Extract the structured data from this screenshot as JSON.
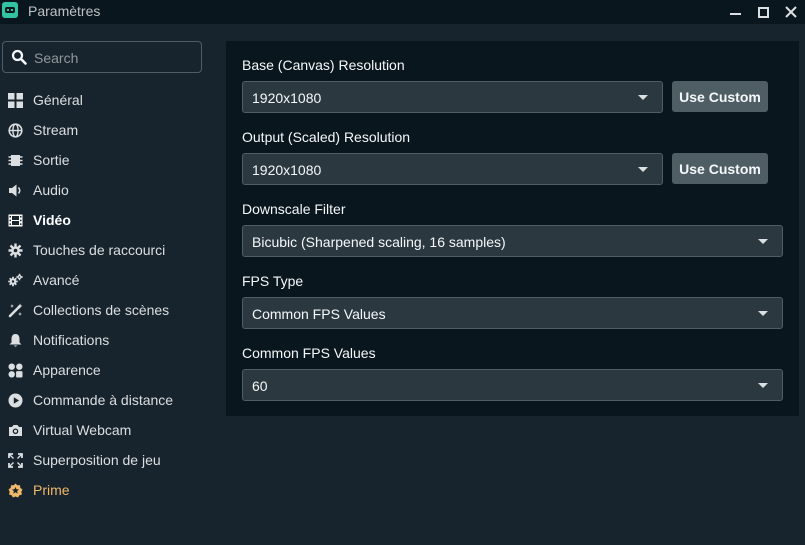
{
  "window": {
    "title": "Paramètres",
    "icons": {
      "app": "streamlabs-logo-icon",
      "minimize": "minimize-icon",
      "maximize": "maximize-icon",
      "close": "close-icon"
    }
  },
  "search": {
    "placeholder": "Search",
    "value": ""
  },
  "sidebar": {
    "items": [
      {
        "label": "Général",
        "icon": "grid-icon"
      },
      {
        "label": "Stream",
        "icon": "globe-icon"
      },
      {
        "label": "Sortie",
        "icon": "chip-icon"
      },
      {
        "label": "Audio",
        "icon": "speaker-icon"
      },
      {
        "label": "Vidéo",
        "icon": "film-icon",
        "active": true
      },
      {
        "label": "Touches de raccourci",
        "icon": "gear-icon"
      },
      {
        "label": "Avancé",
        "icon": "gears-icon"
      },
      {
        "label": "Collections de scènes",
        "icon": "magic-wand-icon"
      },
      {
        "label": "Notifications",
        "icon": "bell-icon"
      },
      {
        "label": "Apparence",
        "icon": "palette-icon"
      },
      {
        "label": "Commande à distance",
        "icon": "play-circle-icon"
      },
      {
        "label": "Virtual Webcam",
        "icon": "camera-icon"
      },
      {
        "label": "Superposition de jeu",
        "icon": "expand-icon"
      },
      {
        "label": "Prime",
        "icon": "prime-badge-icon"
      }
    ]
  },
  "video": {
    "base_resolution": {
      "label": "Base (Canvas) Resolution",
      "value": "1920x1080",
      "button": "Use Custom"
    },
    "output_resolution": {
      "label": "Output (Scaled) Resolution",
      "value": "1920x1080",
      "button": "Use Custom"
    },
    "downscale_filter": {
      "label": "Downscale Filter",
      "value": "Bicubic (Sharpened scaling, 16 samples)"
    },
    "fps_type": {
      "label": "FPS Type",
      "value": "Common FPS Values"
    },
    "common_fps": {
      "label": "Common FPS Values",
      "value": "60"
    }
  },
  "colors": {
    "background": "#17242d",
    "panel": "#09161d",
    "input": "#2b383f",
    "button": "#4f5e65",
    "prime": "#f0b86a",
    "logo": "#31c3a2"
  }
}
